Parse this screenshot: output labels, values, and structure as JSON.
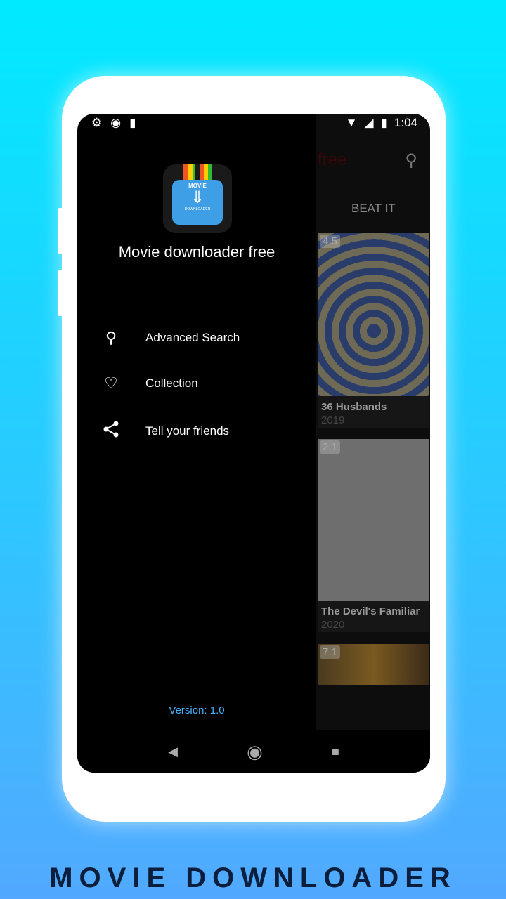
{
  "status_bar": {
    "time": "1:04"
  },
  "drawer": {
    "app_name": "Movie downloader free",
    "logo_text_top": "MOVIE",
    "logo_text_bottom": "DOWNLOADER",
    "items": [
      {
        "label": "Advanced Search",
        "icon": "search-icon"
      },
      {
        "label": "Collection",
        "icon": "heart-icon"
      },
      {
        "label": "Tell your friends",
        "icon": "share-icon"
      }
    ],
    "version": "Version: 1.0"
  },
  "content": {
    "title_fragment": "free",
    "tab": "BEAT IT",
    "movies": [
      {
        "title": "36 Husbands",
        "year": "2019",
        "rating": "4.5"
      },
      {
        "title": "The Devil's Familiar",
        "year": "2020",
        "rating": "2.1"
      },
      {
        "title": "",
        "year": "",
        "rating": "7.1"
      }
    ]
  },
  "footer": {
    "caption": "MOVIE DOWNLOADER"
  },
  "colors": {
    "accent": "#46b4ff",
    "background_top": "#00eaff",
    "background_bottom": "#52a9ff"
  }
}
